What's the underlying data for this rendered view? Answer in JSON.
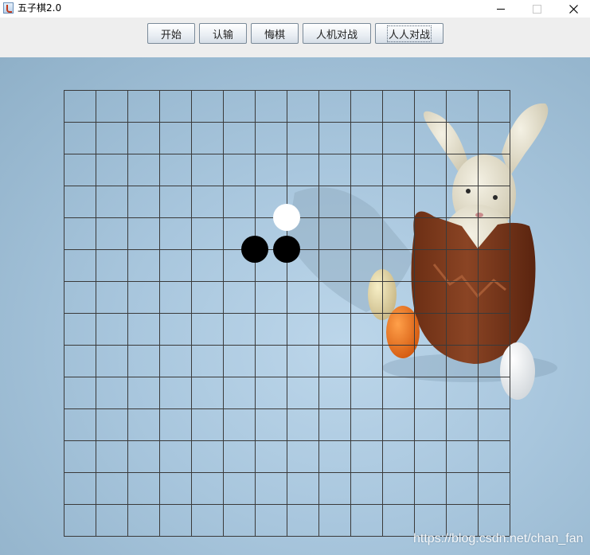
{
  "window": {
    "title": "五子棋2.0",
    "icon": "java-cup-icon"
  },
  "toolbar": {
    "buttons": [
      {
        "id": "start",
        "label": "开始"
      },
      {
        "id": "resign",
        "label": "认输"
      },
      {
        "id": "undo",
        "label": "悔棋"
      },
      {
        "id": "pve",
        "label": "人机对战"
      },
      {
        "id": "pvp",
        "label": "人人对战"
      }
    ],
    "focused_button": "pvp"
  },
  "board": {
    "rows": 15,
    "cols": 15,
    "stones": [
      {
        "color": "black",
        "row": 5,
        "col": 6
      },
      {
        "color": "black",
        "row": 5,
        "col": 7
      },
      {
        "color": "white",
        "row": 4,
        "col": 7
      }
    ],
    "colors": {
      "grid_line": "#3a3a3a",
      "black_stone": "#000000",
      "white_stone": "#ffffff"
    }
  },
  "background_image": "rabbit-in-chocolate-egg-with-eggs",
  "watermark": "https://blog.csdn.net/chan_fan"
}
